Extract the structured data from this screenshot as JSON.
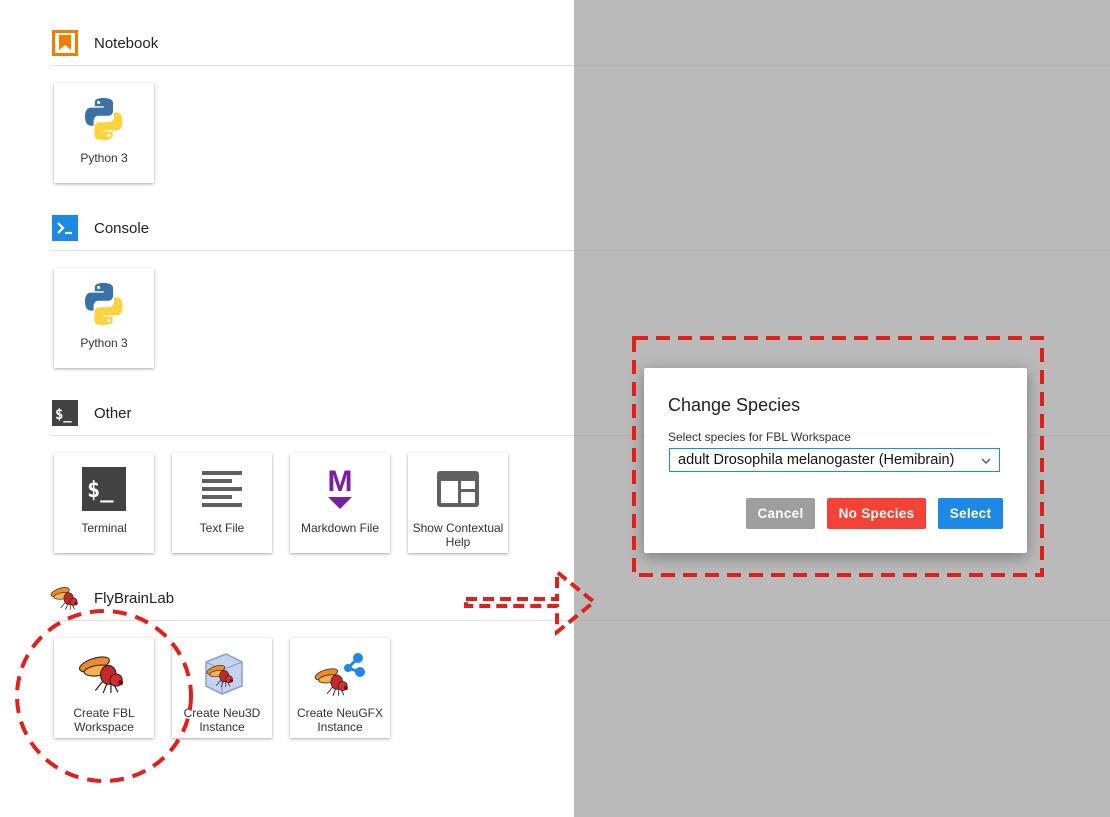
{
  "sections": {
    "notebook": {
      "title": "Notebook",
      "cards": [
        {
          "label": "Python 3"
        }
      ]
    },
    "console": {
      "title": "Console",
      "cards": [
        {
          "label": "Python 3"
        }
      ]
    },
    "other": {
      "title": "Other",
      "cards": [
        {
          "label": "Terminal"
        },
        {
          "label": "Text File"
        },
        {
          "label": "Markdown File"
        },
        {
          "label": "Show Contextual Help"
        }
      ]
    },
    "flybrainlab": {
      "title": "FlyBrainLab",
      "cards": [
        {
          "label": "Create FBL Workspace"
        },
        {
          "label": "Create Neu3D Instance"
        },
        {
          "label": "Create NeuGFX Instance"
        }
      ]
    }
  },
  "dialog": {
    "title": "Change Species",
    "select_label": "Select species for FBL Workspace",
    "selected_species": "adult Drosophila melanogaster (Hemibrain)",
    "buttons": {
      "cancel": "Cancel",
      "no_species": "No Species",
      "select": "Select"
    }
  },
  "icons": {
    "notebook": "notebook-bookmark-icon",
    "console": "console-prompt-icon",
    "other": "terminal-icon",
    "flybrainlab": "fly-icon",
    "python": "python-logo-icon",
    "text_file": "text-lines-icon",
    "markdown": "markdown-m-icon",
    "contextual_help": "window-panel-icon",
    "neu3d": "fly-cube-icon",
    "neugfx": "fly-graph-icon"
  },
  "colors": {
    "notebook_icon": "#f57c00",
    "console_icon": "#1e88e5",
    "terminal_icon": "#424242",
    "markdown_icon": "#7b1fa2",
    "cancel_button": "#9e9e9e",
    "no_species_button": "#f44336",
    "select_button": "#1e88e5",
    "select_border": "#1e88e5",
    "annotation": "#e0201b"
  }
}
